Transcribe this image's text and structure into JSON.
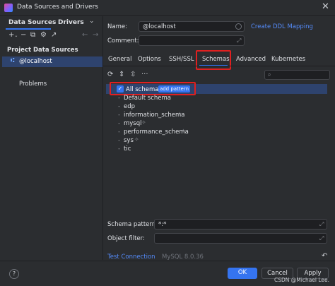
{
  "window": {
    "title": "Data Sources and Drivers"
  },
  "left_panel": {
    "tabs": [
      {
        "label": "Data Sources"
      },
      {
        "label": "Drivers"
      }
    ],
    "section": "Project Data Sources",
    "items": [
      {
        "label": "@localhost"
      }
    ],
    "problems": "Problems"
  },
  "form": {
    "name_label": "Name:",
    "name_value": "@localhost",
    "ddl_link": "Create DDL Mapping",
    "comment_label": "Comment:"
  },
  "tabs": [
    {
      "label": "General"
    },
    {
      "label": "Options"
    },
    {
      "label": "SSH/SSL"
    },
    {
      "label": "Schemas"
    },
    {
      "label": "Advanced"
    },
    {
      "label": "Kubernetes"
    }
  ],
  "schemas": {
    "all_label": "All schemas",
    "all_checked": true,
    "add_pattern": "add pattern",
    "items": [
      {
        "name": "Default schema"
      },
      {
        "name": "edp"
      },
      {
        "name": "information_schema"
      },
      {
        "name": "mysql"
      },
      {
        "name": "performance_schema"
      },
      {
        "name": "sys"
      },
      {
        "name": "tic"
      }
    ]
  },
  "pattern": {
    "label": "Schema pattern:",
    "value": "*:*"
  },
  "filter": {
    "label": "Object filter:"
  },
  "footer": {
    "test_connection": "Test Connection",
    "version": "MySQL 8.0.36",
    "ok": "OK",
    "cancel": "Cancel",
    "apply": "Apply",
    "watermark": "CSDN @Michael Lee."
  },
  "colors": {
    "accent": "#3574f0",
    "highlight": "#e02020",
    "selection": "#2e436e",
    "link": "#548af7"
  }
}
